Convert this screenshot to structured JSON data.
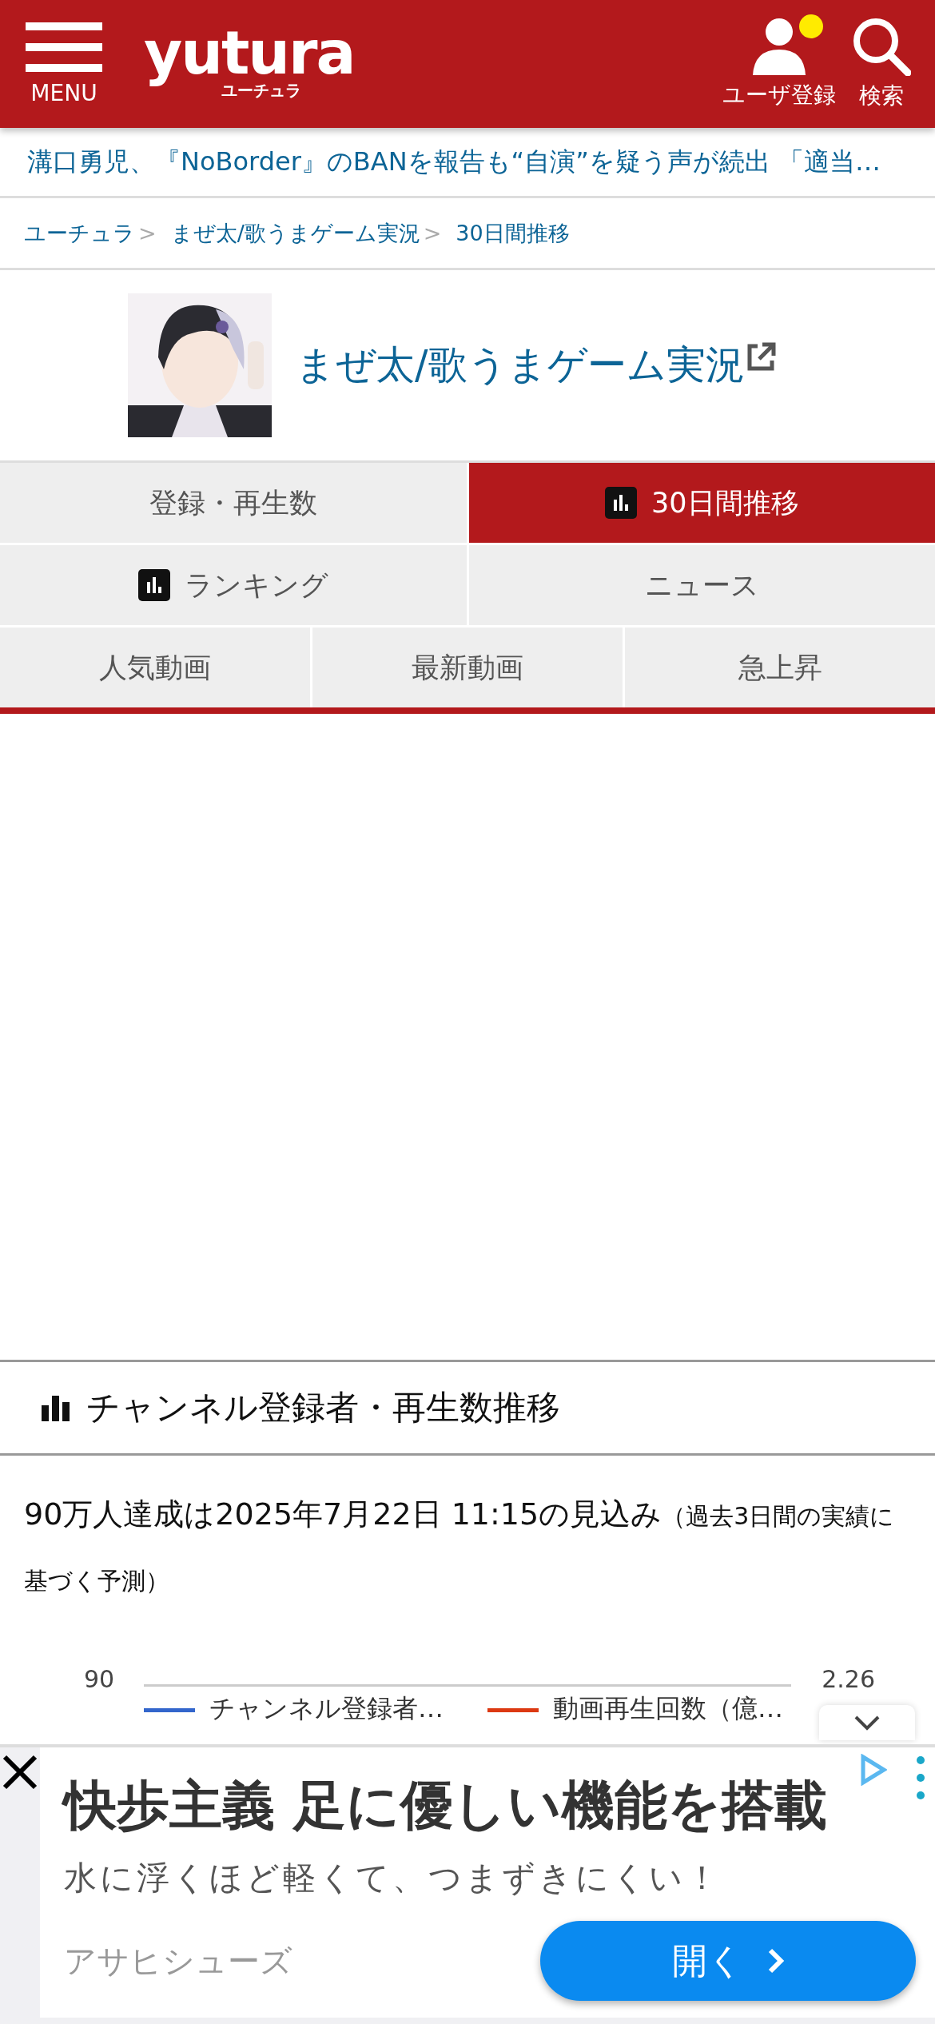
{
  "header": {
    "menu_label": "MENU",
    "logo": {
      "name": "yutura",
      "sub": "ユーチュラ"
    },
    "user": {
      "label": "ユーザ登録",
      "notification": true
    },
    "search_label": "検索"
  },
  "news_ticker": "溝口勇児、『NoBorder』のBANを報告も“自演”を疑う声が続出 「適当…",
  "breadcrumb": [
    {
      "label": "ユーチュラ",
      "separator": ">"
    },
    {
      "label": "まぜ太/歌うまゲーム実況",
      "separator": ">"
    },
    {
      "label": "30日間推移"
    }
  ],
  "channel": {
    "name": "まぜ太/歌うまゲーム実況"
  },
  "tabs": [
    [
      {
        "label": "登録・再生数",
        "selected": false,
        "has_icon": false
      },
      {
        "label": "30日間推移",
        "selected": true,
        "has_icon": true
      }
    ],
    [
      {
        "label": "ランキング",
        "selected": false,
        "has_icon": true
      },
      {
        "label": "ニュース",
        "selected": false,
        "has_icon": false
      }
    ],
    [
      {
        "label": "人気動画",
        "selected": false,
        "has_icon": false
      },
      {
        "label": "最新動画",
        "selected": false,
        "has_icon": false
      },
      {
        "label": "急上昇",
        "selected": false,
        "has_icon": false
      }
    ]
  ],
  "section": {
    "title": "チャンネル登録者・再生数推移"
  },
  "prediction": {
    "main": "90万人達成は2025年7月22日 11:15の見込み",
    "note": "（過去3日間の実績に基づく予測）"
  },
  "chart": {
    "left_tick": "90",
    "right_tick": "2.26",
    "legend": [
      {
        "label": "チャンネル登録者…",
        "color": "#3366cc"
      },
      {
        "label": "動画再生回数（億…",
        "color": "#dc3912"
      }
    ]
  },
  "ad": {
    "headline": "快歩主義 足に優しい機能を搭載",
    "subline": "水に浮くほど軽くて、つまずきにくい！",
    "advertiser": "アサヒシューズ",
    "button": "開く"
  }
}
